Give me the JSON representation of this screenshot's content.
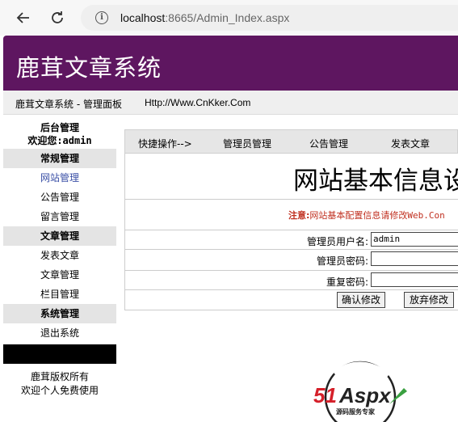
{
  "browser": {
    "url_host": "localhost",
    "url_rest": ":8665/Admin_Index.aspx"
  },
  "banner": {
    "title": "鹿茸文章系统"
  },
  "subbar": {
    "panel": "鹿茸文章系统 - 管理面板",
    "site": "Http://Www.CnKker.Com"
  },
  "sidebar": {
    "admin_title": "后台管理",
    "welcome": "欢迎您:admin",
    "sections": [
      {
        "header": "常规管理",
        "items": [
          "网站管理",
          "公告管理",
          "留言管理"
        ]
      },
      {
        "header": "文章管理",
        "items": [
          "发表文章",
          "文章管理",
          "栏目管理"
        ]
      },
      {
        "header": "系统管理",
        "items": [
          "退出系统"
        ]
      }
    ],
    "copyright_line1": "鹿茸版权所有",
    "copyright_line2": "欢迎个人免费使用"
  },
  "toolbar": {
    "items": [
      "快捷操作-->",
      "管理员管理",
      "公告管理",
      "发表文章"
    ]
  },
  "main": {
    "title": "网站基本信息设",
    "notice_label": "注意:",
    "notice_text": "网站基本配置信息请修改",
    "notice_code": "Web.Con",
    "username_label": "管理员用户名:",
    "username_value": "admin",
    "password_label": "管理员密码:",
    "repeat_label": "重复密码:",
    "confirm_button": "确认修改",
    "cancel_button": "放弃修改"
  },
  "logo": {
    "brand_number": "51",
    "brand_text": "Aspx",
    "tagline": "源码服务专家"
  },
  "colors": {
    "banner": "#5e1660",
    "notice": "#c03020",
    "active_link": "#3a4fa6",
    "logo_red": "#d5202a",
    "logo_green": "#3aa040"
  }
}
